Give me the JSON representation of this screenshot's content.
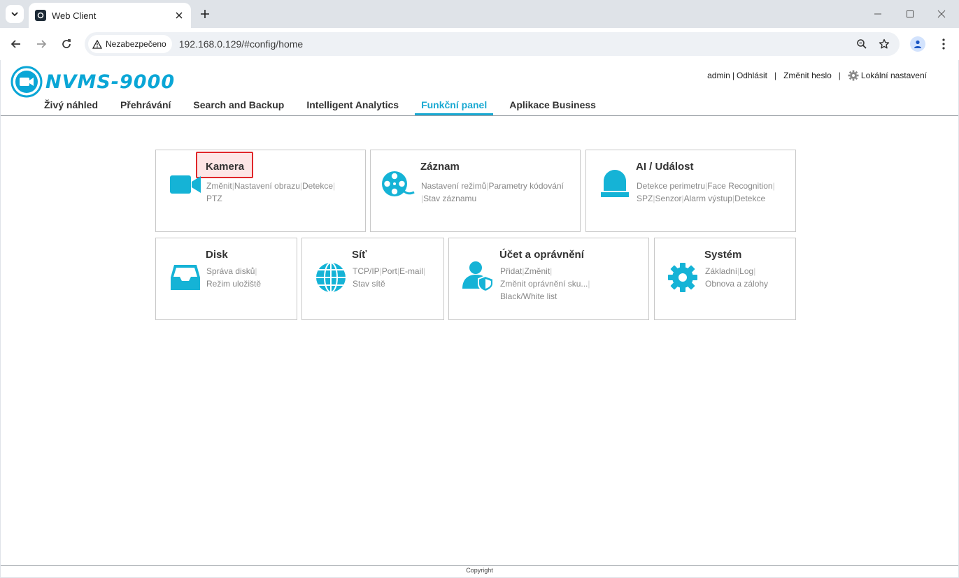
{
  "browser": {
    "tab_title": "Web Client",
    "security_label": "Nezabezpečeno",
    "url": "192.168.0.129/#config/home"
  },
  "app": {
    "logo_text": "NVMS-9000",
    "user_link": "admin",
    "logout_link": "Odhlásit",
    "change_password": "Změnit heslo",
    "local_settings": "Lokální nastavení",
    "nav": [
      {
        "label": "Živý náhled"
      },
      {
        "label": "Přehrávání"
      },
      {
        "label": "Search and Backup"
      },
      {
        "label": "Intelligent Analytics"
      },
      {
        "label": "Funkční panel"
      },
      {
        "label": "Aplikace Business"
      }
    ],
    "accent_color": "#1aa9d2",
    "highlight_color": "#e0262a",
    "footer": "Copyright"
  },
  "cards": {
    "kamera": {
      "title": "Kamera",
      "links": [
        "Změnit",
        "Nastavení obrazu",
        "Detekce",
        "PTZ"
      ]
    },
    "zaznam": {
      "title": "Záznam",
      "links": [
        "Nastavení režimů",
        "Parametry kódování",
        "Stav záznamu"
      ]
    },
    "ai": {
      "title": "AI / Událost",
      "links": [
        "Detekce perimetru",
        "Face Recognition",
        "SPZ",
        "Senzor",
        "Alarm výstup",
        "Detekce"
      ]
    },
    "disk": {
      "title": "Disk",
      "links": [
        "Správa disků",
        "Režim uložiště"
      ]
    },
    "sit": {
      "title": "Síť",
      "links": [
        "TCP/IP",
        "Port",
        "E-mail",
        "Stav sítě"
      ]
    },
    "ucet": {
      "title": "Účet a oprávnění",
      "links": [
        "Přidat",
        "Změnit",
        "Změnit oprávnění sku...",
        "Black/White list"
      ]
    },
    "system": {
      "title": "Systém",
      "links": [
        "Základní",
        "Log",
        "Obnova a zálohy"
      ]
    }
  }
}
